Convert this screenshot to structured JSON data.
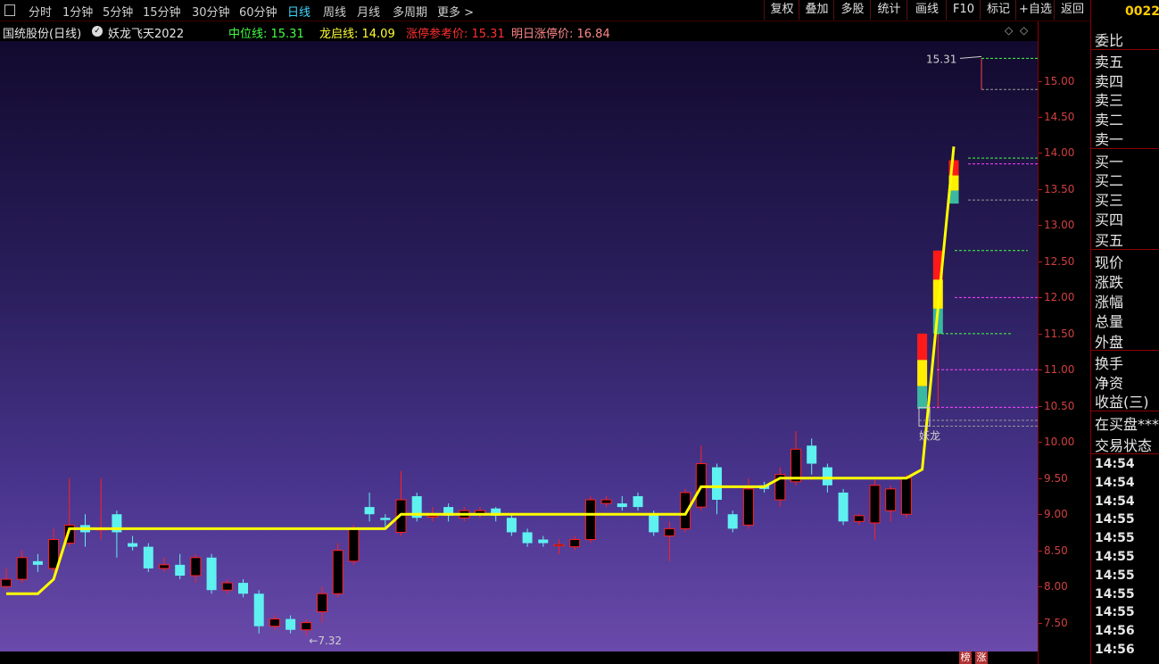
{
  "toolbar": {
    "periods": [
      "分时",
      "1分钟",
      "5分钟",
      "15分钟",
      "30分钟",
      "60分钟",
      "日线",
      "周线",
      "月线",
      "多周期",
      "更多 >"
    ],
    "active_period": "日线",
    "right_buttons": [
      "复权",
      "叠加",
      "多股",
      "统计",
      "画线",
      "F10",
      "标记",
      "+自选",
      "返回"
    ]
  },
  "info": {
    "stock_name": "国统股份(日线)",
    "indicator_name": "妖龙飞天2022",
    "mid_line_label": "中位线: 15.31",
    "dragon_line_label": "龙启线: 14.09",
    "limit_ref_label": "涨停参考价: 15.31",
    "next_limit_label": "明日涨停价: 16.84"
  },
  "colors": {
    "up": "#ff2020",
    "down": "#5ff0f0",
    "line": "#ffff00",
    "axis": "#d04040"
  },
  "chart_data": {
    "type": "candlestick",
    "ylim": [
      7.1,
      15.55
    ],
    "yticks": [
      7.5,
      8.0,
      8.5,
      9.0,
      9.5,
      10.0,
      10.5,
      11.0,
      11.5,
      12.0,
      12.5,
      13.0,
      13.5,
      14.0,
      14.5,
      15.0
    ],
    "annotations": {
      "high_label": "15.31",
      "low_label": "←7.32",
      "signal_label": "妖龙"
    },
    "candles": [
      {
        "o": 8.0,
        "c": 8.1,
        "h": 8.25,
        "l": 7.95
      },
      {
        "o": 8.1,
        "c": 8.4,
        "h": 8.5,
        "l": 8.05
      },
      {
        "o": 8.35,
        "c": 8.3,
        "h": 8.45,
        "l": 8.2
      },
      {
        "o": 8.25,
        "c": 8.65,
        "h": 8.8,
        "l": 8.2
      },
      {
        "o": 8.6,
        "c": 8.85,
        "h": 9.5,
        "l": 8.55
      },
      {
        "o": 8.85,
        "c": 8.75,
        "h": 9.0,
        "l": 8.55
      },
      {
        "o": 8.8,
        "c": 8.8,
        "h": 9.5,
        "l": 8.65
      },
      {
        "o": 9.0,
        "c": 8.75,
        "h": 9.05,
        "l": 8.4
      },
      {
        "o": 8.6,
        "c": 8.55,
        "h": 8.7,
        "l": 8.5
      },
      {
        "o": 8.55,
        "c": 8.25,
        "h": 8.6,
        "l": 8.2
      },
      {
        "o": 8.25,
        "c": 8.3,
        "h": 8.4,
        "l": 8.2
      },
      {
        "o": 8.3,
        "c": 8.15,
        "h": 8.45,
        "l": 8.1
      },
      {
        "o": 8.15,
        "c": 8.4,
        "h": 8.45,
        "l": 8.05
      },
      {
        "o": 8.4,
        "c": 7.95,
        "h": 8.45,
        "l": 7.9
      },
      {
        "o": 7.95,
        "c": 8.05,
        "h": 8.1,
        "l": 7.9
      },
      {
        "o": 8.05,
        "c": 7.9,
        "h": 8.1,
        "l": 7.85
      },
      {
        "o": 7.9,
        "c": 7.45,
        "h": 7.95,
        "l": 7.35
      },
      {
        "o": 7.45,
        "c": 7.55,
        "h": 7.6,
        "l": 7.4
      },
      {
        "o": 7.55,
        "c": 7.4,
        "h": 7.6,
        "l": 7.35
      },
      {
        "o": 7.4,
        "c": 7.5,
        "h": 7.55,
        "l": 7.32
      },
      {
        "o": 7.65,
        "c": 7.9,
        "h": 8.0,
        "l": 7.5
      },
      {
        "o": 7.9,
        "c": 8.5,
        "h": 8.6,
        "l": 7.85
      },
      {
        "o": 8.35,
        "c": 8.8,
        "h": 8.85,
        "l": 8.3
      },
      {
        "o": 9.1,
        "c": 9.0,
        "h": 9.3,
        "l": 8.9
      },
      {
        "o": 8.95,
        "c": 8.92,
        "h": 9.0,
        "l": 8.8
      },
      {
        "o": 8.75,
        "c": 9.2,
        "h": 9.6,
        "l": 8.7
      },
      {
        "o": 9.25,
        "c": 8.95,
        "h": 9.3,
        "l": 8.9
      },
      {
        "o": 8.98,
        "c": 8.98,
        "h": 9.1,
        "l": 8.9
      },
      {
        "o": 9.1,
        "c": 8.98,
        "h": 9.15,
        "l": 8.9
      },
      {
        "o": 8.95,
        "c": 9.05,
        "h": 9.1,
        "l": 8.9
      },
      {
        "o": 9.0,
        "c": 9.05,
        "h": 9.1,
        "l": 8.95
      },
      {
        "o": 9.08,
        "c": 8.98,
        "h": 9.1,
        "l": 8.9
      },
      {
        "o": 8.95,
        "c": 8.75,
        "h": 9.0,
        "l": 8.7
      },
      {
        "o": 8.75,
        "c": 8.6,
        "h": 8.8,
        "l": 8.55
      },
      {
        "o": 8.65,
        "c": 8.6,
        "h": 8.7,
        "l": 8.55
      },
      {
        "o": 8.58,
        "c": 8.58,
        "h": 8.65,
        "l": 8.45
      },
      {
        "o": 8.55,
        "c": 8.65,
        "h": 8.7,
        "l": 8.5
      },
      {
        "o": 8.65,
        "c": 9.2,
        "h": 9.25,
        "l": 8.6
      },
      {
        "o": 9.15,
        "c": 9.2,
        "h": 9.25,
        "l": 9.1
      },
      {
        "o": 9.15,
        "c": 9.1,
        "h": 9.25,
        "l": 9.05
      },
      {
        "o": 9.25,
        "c": 9.1,
        "h": 9.3,
        "l": 9.05
      },
      {
        "o": 9.0,
        "c": 8.75,
        "h": 9.05,
        "l": 8.7
      },
      {
        "o": 8.7,
        "c": 8.8,
        "h": 8.9,
        "l": 8.35
      },
      {
        "o": 8.8,
        "c": 9.3,
        "h": 9.35,
        "l": 8.75
      },
      {
        "o": 9.1,
        "c": 9.7,
        "h": 9.95,
        "l": 9.05
      },
      {
        "o": 9.65,
        "c": 9.2,
        "h": 9.7,
        "l": 9.0
      },
      {
        "o": 9.0,
        "c": 8.8,
        "h": 9.05,
        "l": 8.75
      },
      {
        "o": 8.85,
        "c": 9.35,
        "h": 9.5,
        "l": 8.8
      },
      {
        "o": 9.4,
        "c": 9.35,
        "h": 9.45,
        "l": 9.3
      },
      {
        "o": 9.2,
        "c": 9.55,
        "h": 9.65,
        "l": 9.1
      },
      {
        "o": 9.45,
        "c": 9.9,
        "h": 10.15,
        "l": 9.4
      },
      {
        "o": 9.95,
        "c": 9.7,
        "h": 10.05,
        "l": 9.55
      },
      {
        "o": 9.65,
        "c": 9.4,
        "h": 9.7,
        "l": 9.3
      },
      {
        "o": 9.3,
        "c": 8.9,
        "h": 9.35,
        "l": 8.85
      },
      {
        "o": 8.9,
        "c": 8.98,
        "h": 9.0,
        "l": 8.85
      },
      {
        "o": 8.88,
        "c": 9.4,
        "h": 9.5,
        "l": 8.65
      },
      {
        "o": 9.05,
        "c": 9.35,
        "h": 9.4,
        "l": 8.9
      },
      {
        "o": 9.0,
        "c": 9.5,
        "h": 9.55,
        "l": 8.95
      },
      {
        "o": 10.46,
        "c": 11.5,
        "h": 11.5,
        "l": 10.45
      },
      {
        "o": 11.5,
        "c": 12.65,
        "h": 12.65,
        "l": 10.46
      },
      {
        "o": 13.3,
        "c": 13.9,
        "h": 13.93,
        "l": 13.3
      }
    ],
    "line": [
      {
        "i": 0,
        "v": 7.9
      },
      {
        "i": 2,
        "v": 7.9
      },
      {
        "i": 3,
        "v": 8.1
      },
      {
        "i": 4,
        "v": 8.8
      },
      {
        "i": 24,
        "v": 8.8
      },
      {
        "i": 25,
        "v": 9.0
      },
      {
        "i": 43,
        "v": 9.0
      },
      {
        "i": 44,
        "v": 9.38
      },
      {
        "i": 48,
        "v": 9.38
      },
      {
        "i": 49,
        "v": 9.5
      },
      {
        "i": 57,
        "v": 9.5
      },
      {
        "i": 58,
        "v": 9.62
      },
      {
        "i": 60,
        "v": 14.09
      }
    ]
  },
  "right_panel": {
    "code": "0022",
    "labels": [
      "委比",
      "卖五",
      "卖四",
      "卖三",
      "卖二",
      "卖一",
      "买一",
      "买二",
      "买三",
      "买四",
      "买五",
      "现价",
      "涨跌",
      "涨幅",
      "总量",
      "外盘",
      "换手",
      "净资",
      "收益(三)",
      "在买盘***",
      "交易状态"
    ],
    "times": [
      "14:54",
      "14:54",
      "14:54",
      "14:55",
      "14:55",
      "14:55",
      "14:55",
      "14:55",
      "14:55",
      "14:56",
      "14:56"
    ]
  },
  "bottom_tags": [
    "榜",
    "涨"
  ]
}
